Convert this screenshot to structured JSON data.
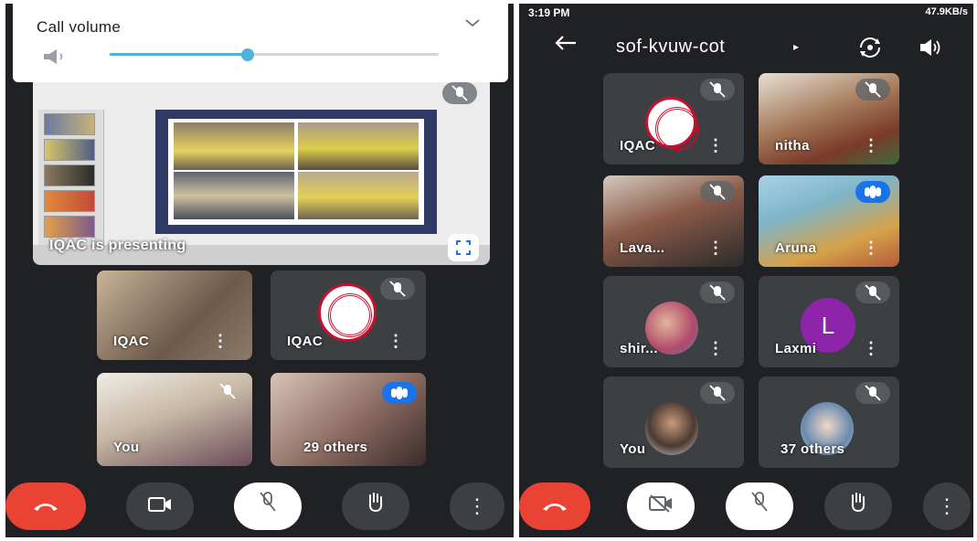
{
  "left_screen": {
    "volume_panel": {
      "title": "Call volume",
      "chevron_icon": "chevron-down-icon",
      "speaker_icon": "volume-icon",
      "level_percent": 42
    },
    "presentation": {
      "label": "IQAC is presenting",
      "fullscreen_icon": "fullscreen-icon",
      "mute_icon": "mic-off-icon"
    },
    "tiles": [
      {
        "name": "IQAC",
        "kind": "video",
        "muted": false
      },
      {
        "name": "IQAC",
        "kind": "logo",
        "muted": true
      },
      {
        "name": "You",
        "kind": "video",
        "muted": true
      },
      {
        "name": "29 others",
        "kind": "video",
        "speaking": true
      }
    ],
    "more_icon": "more-vert-icon",
    "controls": [
      {
        "icon": "end-call-icon",
        "style": "red"
      },
      {
        "icon": "camera-icon",
        "style": "dark"
      },
      {
        "icon": "mic-off-icon",
        "style": "white"
      },
      {
        "icon": "raise-hand-icon",
        "style": "dark"
      },
      {
        "icon": "more-vert-icon",
        "style": "dark"
      }
    ]
  },
  "right_screen": {
    "status_bar": {
      "time": "3:19 PM",
      "right_text": "47.9KB/s"
    },
    "meeting_code": "sof-kvuw-cot",
    "top_icons": [
      "back-arrow-icon",
      "caret-right-icon",
      "switch-camera-icon",
      "speaker-icon"
    ],
    "tiles": [
      {
        "name": "IQAC",
        "kind": "logo",
        "muted": true
      },
      {
        "name": "nitha",
        "kind": "video",
        "muted": true
      },
      {
        "name": "Lava...",
        "kind": "video",
        "muted": true
      },
      {
        "name": "Aruna",
        "kind": "video",
        "speaking": true
      },
      {
        "name": "shir...",
        "kind": "avatar-photo",
        "muted": true
      },
      {
        "name": "Laxmi",
        "kind": "avatar-letter",
        "letter": "L",
        "muted": true
      },
      {
        "name": "You",
        "kind": "avatar-photo",
        "muted": true
      },
      {
        "name": "37 others",
        "kind": "avatar-photo",
        "muted": true
      }
    ],
    "controls": [
      {
        "icon": "end-call-icon",
        "style": "red"
      },
      {
        "icon": "camera-off-icon",
        "style": "white"
      },
      {
        "icon": "mic-off-icon",
        "style": "white"
      },
      {
        "icon": "raise-hand-icon",
        "style": "dark"
      },
      {
        "icon": "more-vert-icon",
        "style": "dark"
      }
    ]
  },
  "colors": {
    "background": "#202124",
    "tile": "#3c4043",
    "end_call": "#ea4335",
    "speaking": "#1a73e8",
    "slider": "#4fb3d9",
    "avatar_laxmi": "#8e24aa"
  }
}
